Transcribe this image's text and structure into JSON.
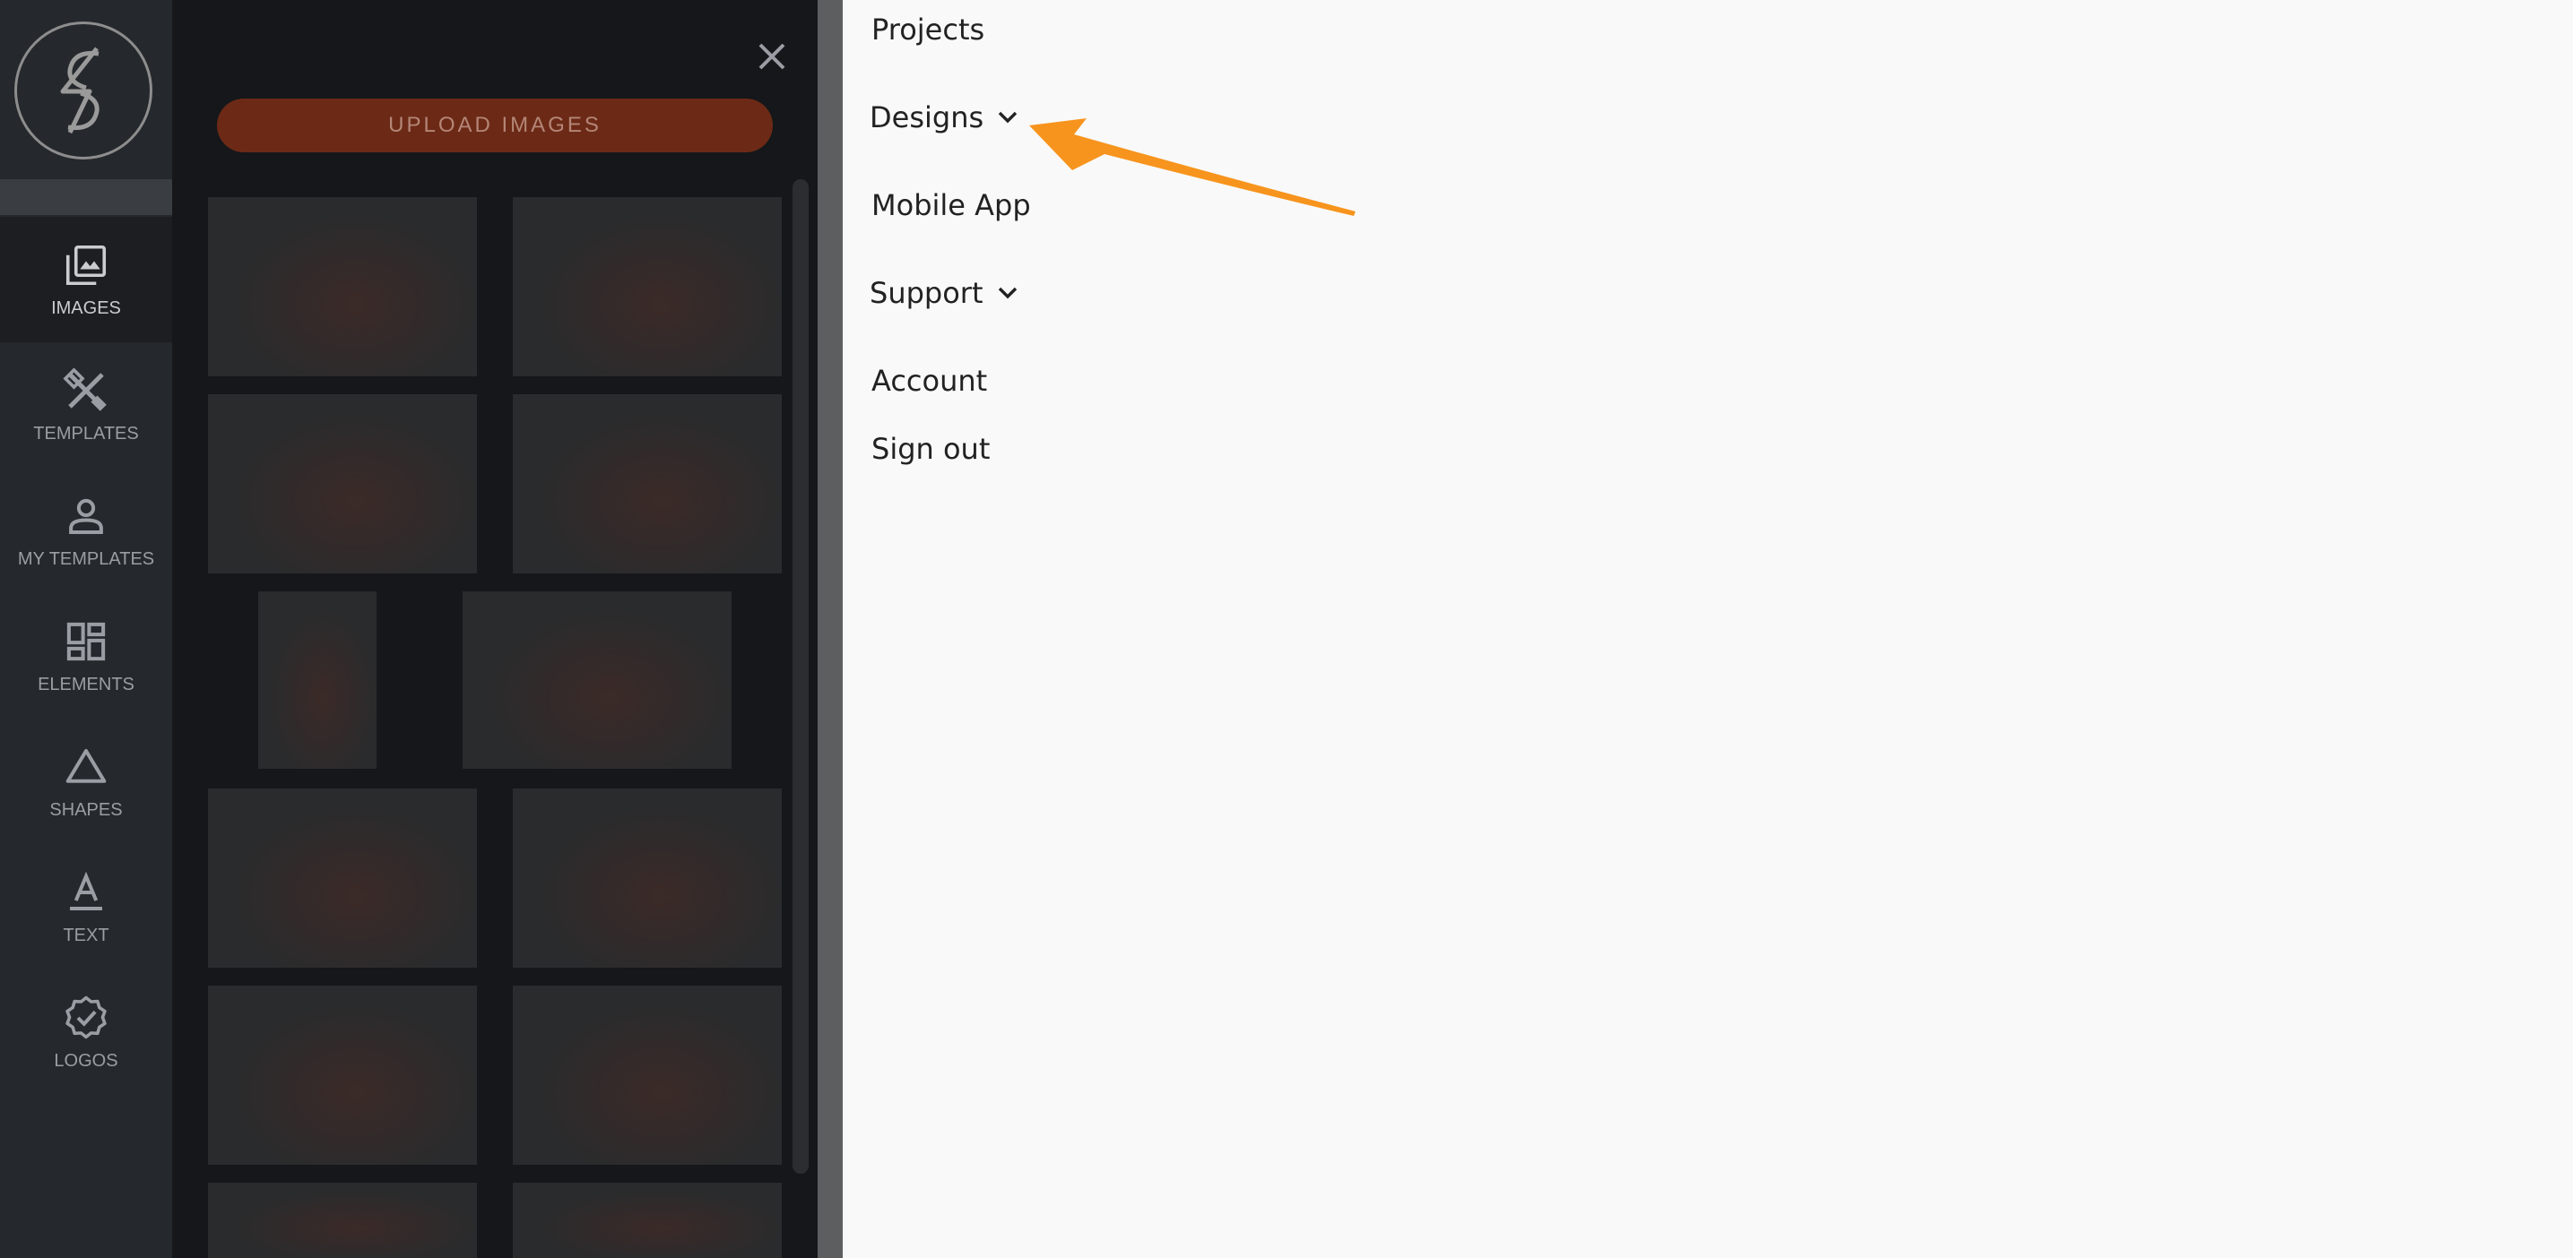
{
  "sidebar": {
    "items": [
      {
        "label": "IMAGES",
        "icon": "images-icon",
        "active": true
      },
      {
        "label": "TEMPLATES",
        "icon": "templates-icon",
        "active": false
      },
      {
        "label": "MY TEMPLATES",
        "icon": "person-icon",
        "active": false
      },
      {
        "label": "ELEMENTS",
        "icon": "dashboard-icon",
        "active": false
      },
      {
        "label": "SHAPES",
        "icon": "triangle-icon",
        "active": false
      },
      {
        "label": "TEXT",
        "icon": "text-icon",
        "active": false
      },
      {
        "label": "LOGOS",
        "icon": "verified-badge-icon",
        "active": false
      }
    ]
  },
  "panel": {
    "upload_label": "UPLOAD IMAGES",
    "close_icon": "close-icon"
  },
  "menu": {
    "items": [
      {
        "label": "Projects",
        "has_chevron": false
      },
      {
        "label": "Designs",
        "has_chevron": true
      },
      {
        "label": "Mobile App",
        "has_chevron": false
      },
      {
        "label": "Support",
        "has_chevron": true
      },
      {
        "label": "Account",
        "has_chevron": false
      },
      {
        "label": "Sign out",
        "has_chevron": false
      }
    ]
  },
  "colors": {
    "accent": "#6c2a16",
    "annotation_arrow": "#f7941d"
  }
}
